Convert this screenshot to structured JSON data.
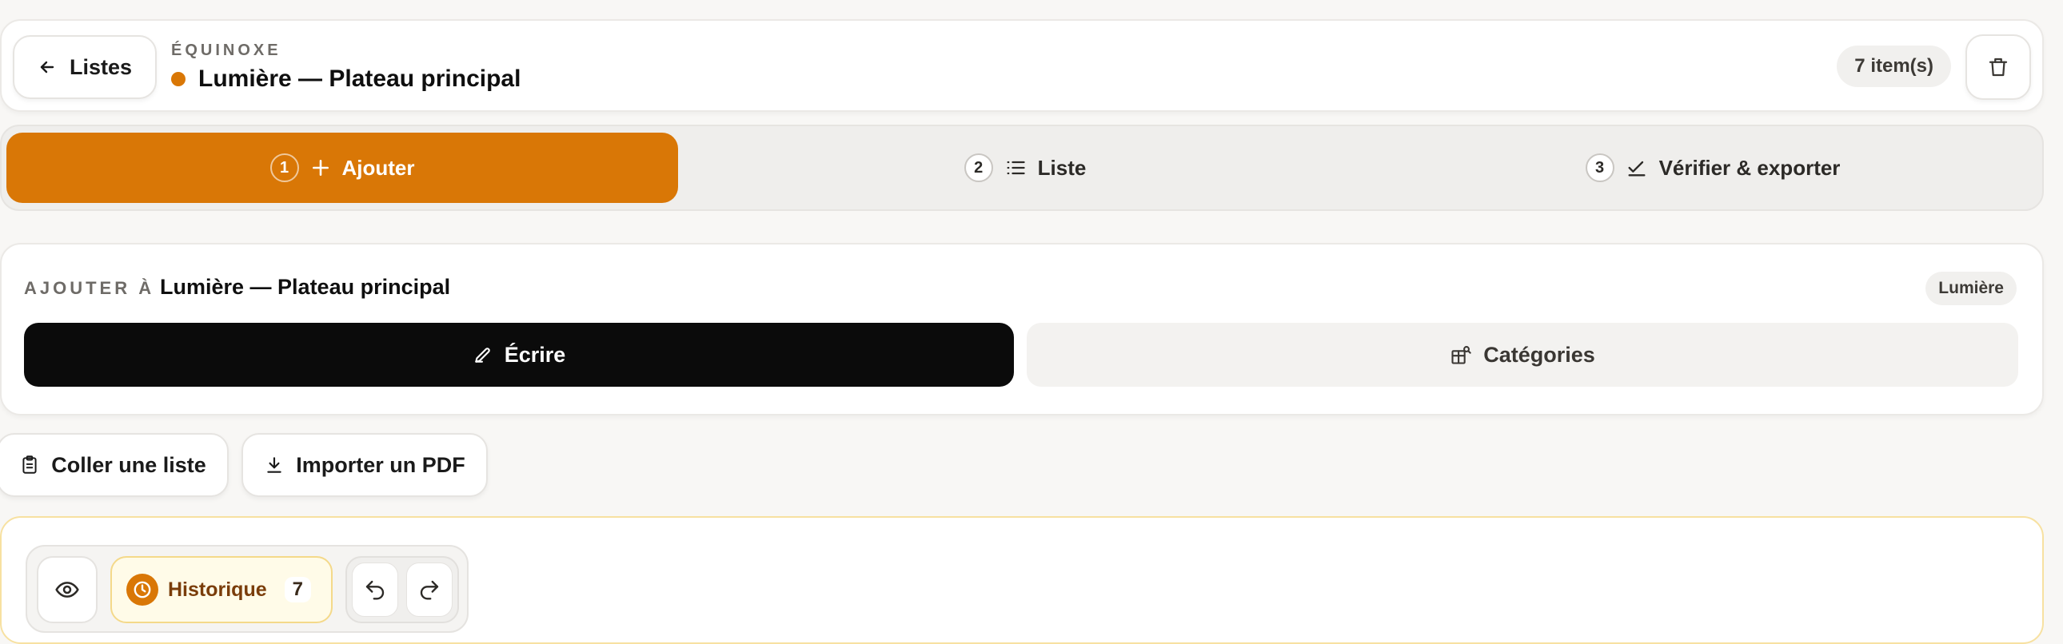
{
  "header": {
    "back_label": "Listes",
    "project_label": "ÉQUINOXE",
    "project_title": "Lumière — Plateau principal",
    "item_count": "7 item(s)"
  },
  "stepper": {
    "steps": [
      {
        "num": "1",
        "label": "Ajouter"
      },
      {
        "num": "2",
        "label": "Liste"
      },
      {
        "num": "3",
        "label": "Vérifier & exporter"
      }
    ]
  },
  "add_panel": {
    "label": "AJOUTER À",
    "target": "Lumière — Plateau principal",
    "category_badge": "Lumière",
    "tabs": {
      "write": "Écrire",
      "categories": "Catégories"
    }
  },
  "import": {
    "paste_label": "Coller une liste",
    "pdf_label": "Importer un PDF"
  },
  "editor_toolbar": {
    "history_label": "Historique",
    "history_count": "7"
  },
  "colors": {
    "accent": "#d97706",
    "dark_tab": "#0b0b0b",
    "history_bg": "#fffbe8"
  },
  "icons": [
    "arrow-left-icon",
    "trash-icon",
    "plus-icon",
    "list-icon",
    "check-icon",
    "pencil-icon",
    "categories-icon",
    "clipboard-icon",
    "download-icon",
    "eye-icon",
    "clock-icon",
    "undo-icon",
    "redo-icon"
  ]
}
